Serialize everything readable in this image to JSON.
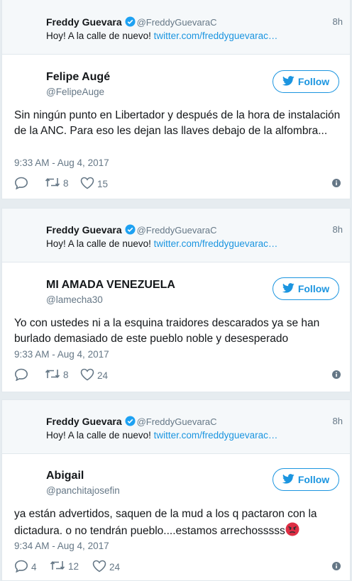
{
  "quoted_tweet": {
    "name": "Freddy Guevara",
    "handle": "@FreddyGuevaraC",
    "time": "8h",
    "text": "Hoy! A la calle de nuevo! ",
    "link": "twitter.com/freddyguevarac…"
  },
  "follow_label": "Follow",
  "tweets": [
    {
      "name": "Felipe Augé",
      "handle": "@FelipeAuge",
      "text": "Sin ningún punto en Libertador y después de la hora de instalación de la ANC. Para eso les dejan las llaves debajo de la alfombra...",
      "time": "9:33 AM - Aug 4, 2017",
      "replies": "",
      "retweets": "8",
      "likes": "15"
    },
    {
      "name": "MI AMADA VENEZUELA",
      "handle": "@lamecha30",
      "text": "Yo con ustedes ni a la esquina traidores descarados ya se han burlado demasiado de este pueblo noble y desesperado",
      "time": "9:33 AM - Aug 4, 2017",
      "replies": "",
      "retweets": "8",
      "likes": "24"
    },
    {
      "name": "Abigail",
      "handle": "@panchitajosefin",
      "text": "ya están advertidos, saquen de la mud a los q pactaron con la dictadura. o no tendrán pueblo....estamos arrechosssss",
      "time": "9:34 AM - Aug 4, 2017",
      "replies": "4",
      "retweets": "12",
      "likes": "24"
    }
  ],
  "icons": {
    "verified": "verified-badge-icon",
    "follow": "twitter-bird-icon",
    "reply": "reply-icon",
    "retweet": "retweet-icon",
    "like": "heart-icon",
    "info": "info-icon",
    "emoji": "angry-face-emoji"
  },
  "colors": {
    "accent": "#1b95e0",
    "quoted_bg": "#f5f8fa",
    "muted": "#657786",
    "page_bg": "#e6ecf0"
  }
}
